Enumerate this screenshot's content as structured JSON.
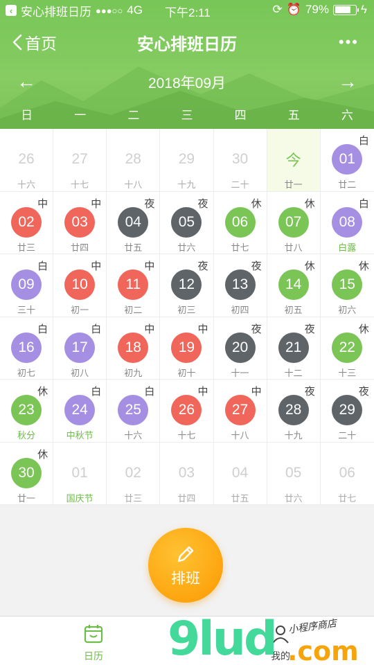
{
  "status_bar": {
    "back_app": "安心排班日历",
    "signal": "●●●○○",
    "network": "4G",
    "time": "下午2:11",
    "battery_text": "79%",
    "battery_level": 0.79
  },
  "nav": {
    "back_label": "首页",
    "title": "安心排班日历",
    "more_label": "•••"
  },
  "month": {
    "label": "2018年09月",
    "prev_arrow": "←",
    "next_arrow": "→"
  },
  "weekdays": [
    "日",
    "一",
    "二",
    "三",
    "四",
    "五",
    "六"
  ],
  "colors": {
    "header_green": "#78c657",
    "day_shift_purple": "#a58fe3",
    "mid_shift_red": "#f0665a",
    "night_shift_gray": "#5f6468",
    "rest_green": "#7ac555",
    "festival_text": "#6dbb49",
    "fab_orange": "#fda50f"
  },
  "calendar": {
    "weeks": [
      [
        {
          "num": "26",
          "lunar": "十六",
          "type": "muted"
        },
        {
          "num": "27",
          "lunar": "十七",
          "type": "muted"
        },
        {
          "num": "28",
          "lunar": "十八",
          "type": "muted"
        },
        {
          "num": "29",
          "lunar": "十九",
          "type": "muted"
        },
        {
          "num": "30",
          "lunar": "二十",
          "type": "muted"
        },
        {
          "num": "今",
          "lunar": "廿一",
          "type": "today"
        },
        {
          "num": "01",
          "lunar": "廿二",
          "shift": "白",
          "type": "day"
        }
      ],
      [
        {
          "num": "02",
          "lunar": "廿三",
          "shift": "中",
          "type": "mid"
        },
        {
          "num": "03",
          "lunar": "廿四",
          "shift": "中",
          "type": "mid"
        },
        {
          "num": "04",
          "lunar": "廿五",
          "shift": "夜",
          "type": "night"
        },
        {
          "num": "05",
          "lunar": "廿六",
          "shift": "夜",
          "type": "night"
        },
        {
          "num": "06",
          "lunar": "廿七",
          "shift": "休",
          "type": "rest"
        },
        {
          "num": "07",
          "lunar": "廿八",
          "shift": "休",
          "type": "rest"
        },
        {
          "num": "08",
          "lunar": "白露",
          "shift": "白",
          "type": "day",
          "festival": true
        }
      ],
      [
        {
          "num": "09",
          "lunar": "三十",
          "shift": "白",
          "type": "day"
        },
        {
          "num": "10",
          "lunar": "初一",
          "shift": "中",
          "type": "mid"
        },
        {
          "num": "11",
          "lunar": "初二",
          "shift": "中",
          "type": "mid"
        },
        {
          "num": "12",
          "lunar": "初三",
          "shift": "夜",
          "type": "night"
        },
        {
          "num": "13",
          "lunar": "初四",
          "shift": "夜",
          "type": "night"
        },
        {
          "num": "14",
          "lunar": "初五",
          "shift": "休",
          "type": "rest"
        },
        {
          "num": "15",
          "lunar": "初六",
          "shift": "休",
          "type": "rest"
        }
      ],
      [
        {
          "num": "16",
          "lunar": "初七",
          "shift": "白",
          "type": "day"
        },
        {
          "num": "17",
          "lunar": "初八",
          "shift": "白",
          "type": "day"
        },
        {
          "num": "18",
          "lunar": "初九",
          "shift": "中",
          "type": "mid"
        },
        {
          "num": "19",
          "lunar": "初十",
          "shift": "中",
          "type": "mid"
        },
        {
          "num": "20",
          "lunar": "十一",
          "shift": "夜",
          "type": "night"
        },
        {
          "num": "21",
          "lunar": "十二",
          "shift": "夜",
          "type": "night"
        },
        {
          "num": "22",
          "lunar": "十三",
          "shift": "休",
          "type": "rest"
        }
      ],
      [
        {
          "num": "23",
          "lunar": "秋分",
          "shift": "休",
          "type": "rest",
          "festival": true
        },
        {
          "num": "24",
          "lunar": "中秋节",
          "shift": "白",
          "type": "day",
          "festival": true
        },
        {
          "num": "25",
          "lunar": "十六",
          "shift": "白",
          "type": "day"
        },
        {
          "num": "26",
          "lunar": "十七",
          "shift": "中",
          "type": "mid"
        },
        {
          "num": "27",
          "lunar": "十八",
          "shift": "中",
          "type": "mid"
        },
        {
          "num": "28",
          "lunar": "十九",
          "shift": "夜",
          "type": "night"
        },
        {
          "num": "29",
          "lunar": "二十",
          "shift": "夜",
          "type": "night"
        }
      ],
      [
        {
          "num": "30",
          "lunar": "廿一",
          "shift": "休",
          "type": "rest"
        },
        {
          "num": "01",
          "lunar": "国庆节",
          "type": "muted",
          "festival": true
        },
        {
          "num": "02",
          "lunar": "廿三",
          "type": "muted"
        },
        {
          "num": "03",
          "lunar": "廿四",
          "type": "muted"
        },
        {
          "num": "04",
          "lunar": "廿五",
          "type": "muted"
        },
        {
          "num": "05",
          "lunar": "廿六",
          "type": "muted"
        },
        {
          "num": "06",
          "lunar": "廿七",
          "type": "muted"
        }
      ]
    ]
  },
  "fab": {
    "label": "排班",
    "icon": "pencil-icon"
  },
  "tabbar": {
    "items": [
      {
        "label": "日历",
        "icon": "calendar-icon",
        "active": true
      },
      {
        "label": "我的",
        "icon": "person-icon",
        "active": false
      }
    ]
  },
  "watermark": {
    "big": "9lud",
    "com": ".com",
    "sub": "小程序商店"
  }
}
